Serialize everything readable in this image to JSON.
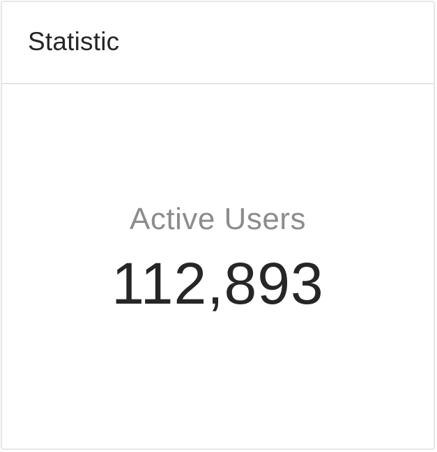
{
  "card": {
    "title": "Statistic"
  },
  "statistic": {
    "title": "Active Users",
    "value": "112,893"
  }
}
